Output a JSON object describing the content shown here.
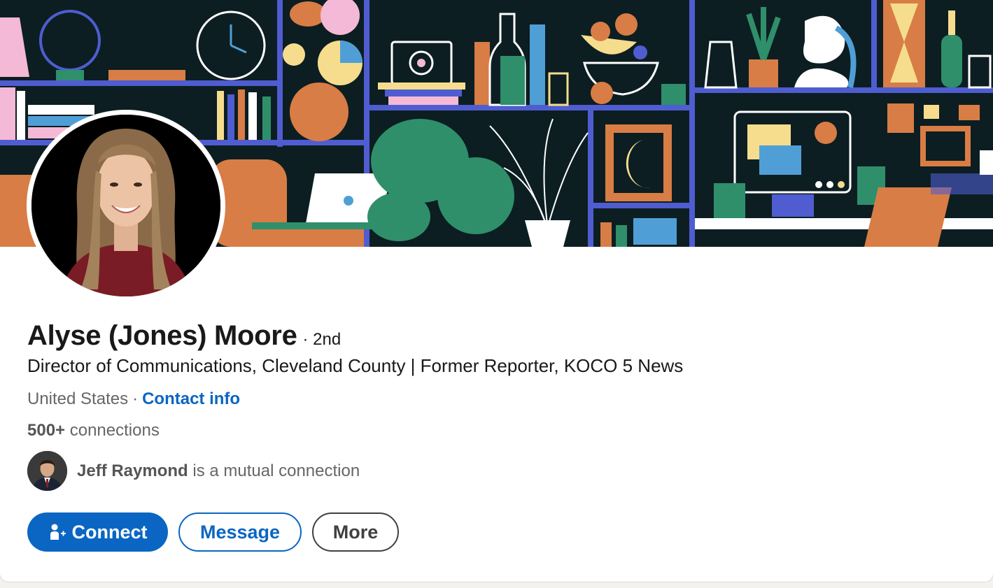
{
  "profile": {
    "name": "Alyse (Jones) Moore",
    "degree": "· 2nd",
    "headline": "Director of Communications, Cleveland County | Former Reporter, KOCO 5 News",
    "location": "United States",
    "separator": "·",
    "contact_info": "Contact info",
    "connections_count": "500+",
    "connections_label": "connections",
    "mutual_name": "Jeff Raymond",
    "mutual_suffix": "is a mutual connection"
  },
  "actions": {
    "connect": "Connect",
    "message": "Message",
    "more": "More"
  },
  "icons": {
    "connect": "add-person-icon"
  },
  "colors": {
    "accent": "#0a66c2",
    "text": "#191919",
    "muted": "#666666"
  }
}
